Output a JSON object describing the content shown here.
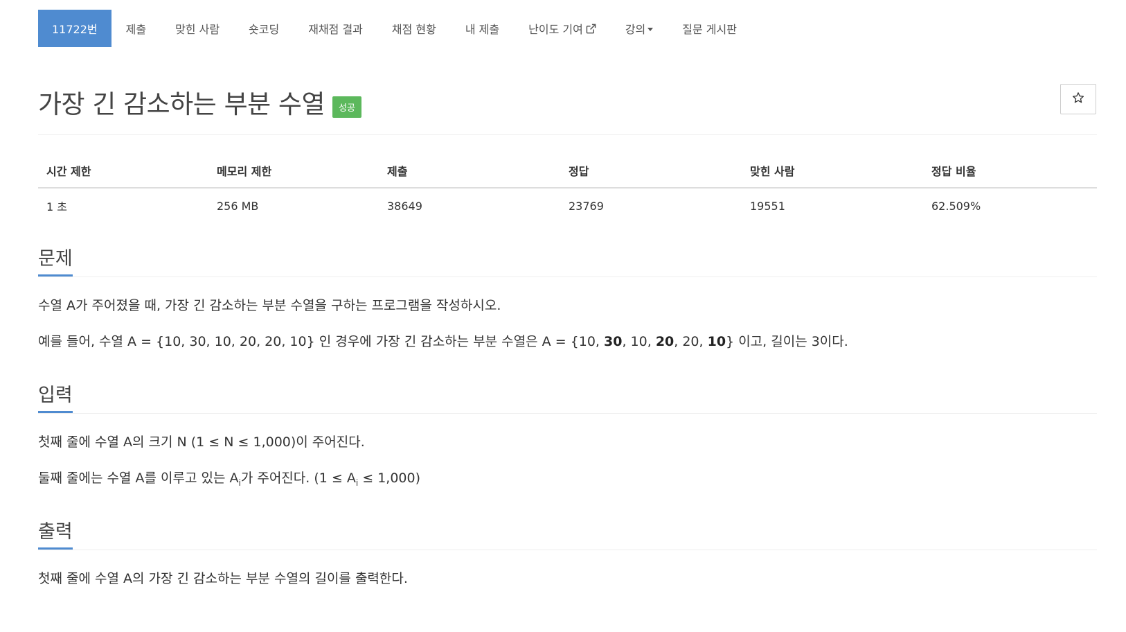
{
  "nav": {
    "problem_id": "11722번",
    "items": [
      "제출",
      "맞힌 사람",
      "숏코딩",
      "재채점 결과",
      "채점 현황",
      "내 제출"
    ],
    "difficulty": "난이도 기여",
    "lecture": "강의",
    "board": "질문 게시판"
  },
  "title": {
    "text": "가장 긴 감소하는 부분 수열",
    "badge": "성공",
    "star": "☆"
  },
  "info": {
    "headers": [
      "시간 제한",
      "메모리 제한",
      "제출",
      "정답",
      "맞힌 사람",
      "정답 비율"
    ],
    "values": [
      "1 초",
      "256 MB",
      "38649",
      "23769",
      "19551",
      "62.509%"
    ]
  },
  "sections": {
    "problem": {
      "title": "문제",
      "line1": "수열 A가 주어졌을 때, 가장 긴 감소하는 부분 수열을 구하는 프로그램을 작성하시오.",
      "line2_prefix": "예를 들어, 수열 A = {10, 30, 10, 20, 20, 10} 인 경우에 가장 긴 감소하는 부분 수열은 A = {10, ",
      "b1": "30",
      "sep1": ", 10, ",
      "b2": "20",
      "sep2": ", 20, ",
      "b3": "10",
      "line2_suffix": "}  이고, 길이는 3이다."
    },
    "input": {
      "title": "입력",
      "line1": "첫째 줄에 수열 A의 크기 N (1 ≤ N ≤ 1,000)이 주어진다.",
      "line2_a": "둘째 줄에는 수열 A를 이루고 있는 A",
      "sub1": "i",
      "line2_b": "가 주어진다. (1 ≤ A",
      "sub2": "i",
      "line2_c": " ≤ 1,000)"
    },
    "output": {
      "title": "출력",
      "line1": "첫째 줄에 수열 A의 가장 긴 감소하는 부분 수열의 길이를 출력한다."
    }
  },
  "colors": {
    "accent": "#4f8bd0",
    "success": "#5cb85c"
  }
}
